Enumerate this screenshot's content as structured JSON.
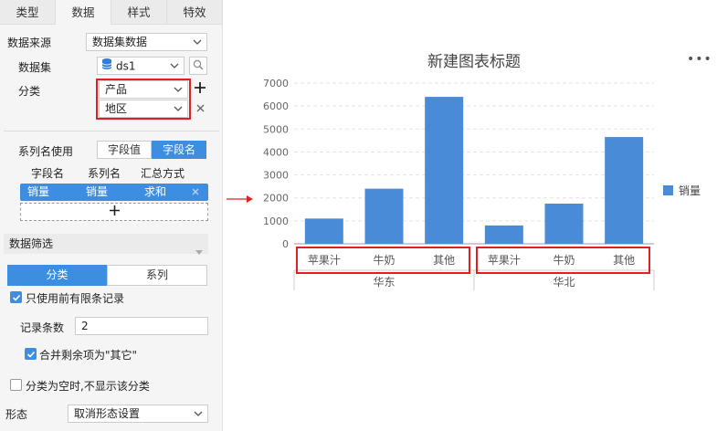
{
  "tabs": [
    "类型",
    "数据",
    "样式",
    "特效"
  ],
  "active_tab": "数据",
  "data_source": {
    "label": "数据来源",
    "value": "数据集数据"
  },
  "dataset": {
    "label": "数据集",
    "value": "ds1"
  },
  "category": {
    "label": "分类",
    "values": [
      "产品",
      "地区"
    ]
  },
  "series_name": {
    "label": "系列名使用",
    "options": [
      "字段值",
      "字段名"
    ],
    "selected": "字段名"
  },
  "field_table": {
    "headers": [
      "字段名",
      "系列名",
      "汇总方式"
    ],
    "row": [
      "销量",
      "销量",
      "求和"
    ]
  },
  "filter_section": {
    "title": "数据筛选"
  },
  "filter_tabs": {
    "options": [
      "分类",
      "系列"
    ],
    "selected": "分类"
  },
  "only_top_records": {
    "label": "只使用前有限条记录",
    "checked": true
  },
  "record_count": {
    "label": "记录条数",
    "value": "2"
  },
  "merge_rest": {
    "label": "合并剩余项为\"其它\"",
    "checked": true
  },
  "hide_empty": {
    "label": "分类为空时,不显示该分类",
    "checked": false
  },
  "morph": {
    "label": "形态",
    "value": "取消形态设置"
  },
  "colors": {
    "accent": "#3d8de0",
    "bar": "#4a8bd8",
    "highlight": "#e02020"
  },
  "chart_data": {
    "type": "bar",
    "title": "新建图表标题",
    "categories": [
      "苹果汁",
      "牛奶",
      "其他",
      "苹果汁",
      "牛奶",
      "其他"
    ],
    "groups": [
      {
        "label": "华东",
        "categories": [
          "苹果汁",
          "牛奶",
          "其他"
        ]
      },
      {
        "label": "华北",
        "categories": [
          "苹果汁",
          "牛奶",
          "其他"
        ]
      }
    ],
    "series": [
      {
        "name": "销量",
        "values": [
          1100,
          2400,
          6400,
          800,
          1750,
          4650
        ]
      }
    ],
    "ylim": [
      0,
      7000
    ],
    "yticks": [
      0,
      1000,
      2000,
      3000,
      4000,
      5000,
      6000,
      7000
    ],
    "legend": "right",
    "grid": true
  }
}
